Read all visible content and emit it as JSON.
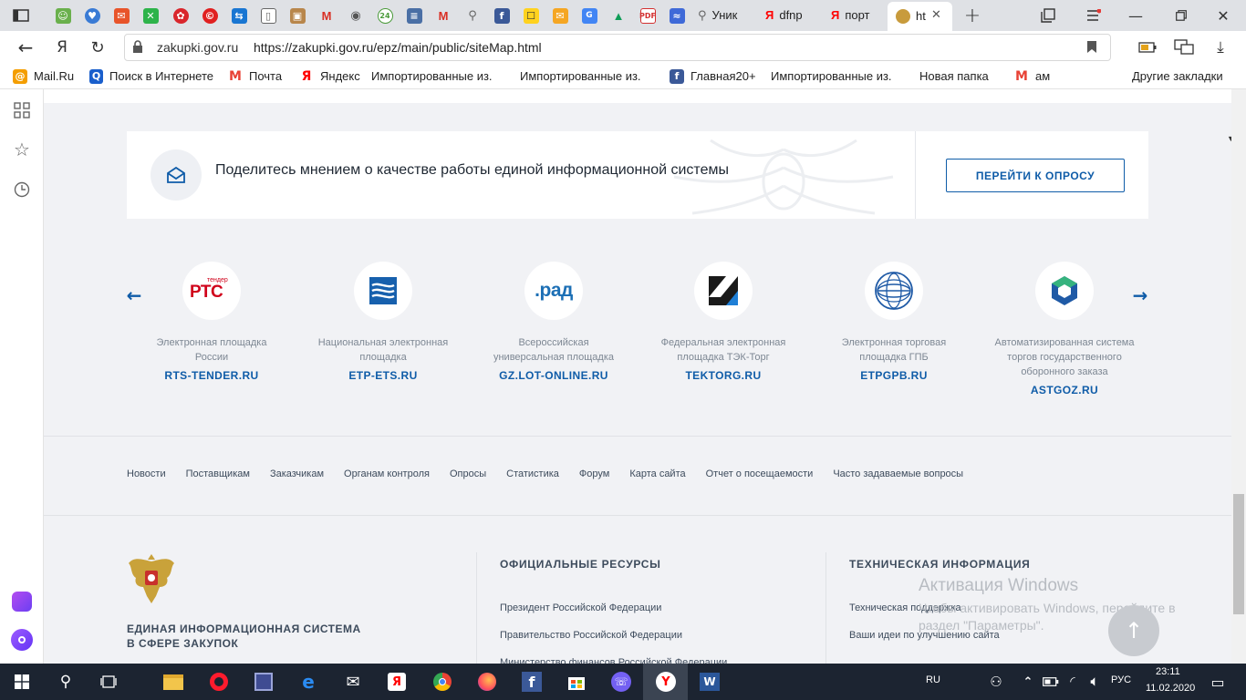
{
  "browser": {
    "tabs": [
      {
        "title": "Уник",
        "glyph": "⚲"
      },
      {
        "title": "dfnp",
        "glyph": "Я"
      },
      {
        "title": "порт",
        "glyph": "Я"
      },
      {
        "title": "ht",
        "glyph": "",
        "active": true
      }
    ],
    "address_domain": "zakupki.gov.ru",
    "address_url": "https://zakupki.gov.ru/epz/main/public/siteMap.html",
    "bookmarks": [
      {
        "label": "Mail.Ru",
        "icon": "mail-ru-icon",
        "color": "#f49e00",
        "glyph": "@"
      },
      {
        "label": "Поиск в Интернете",
        "icon": "search-icon",
        "color": "#1a5fcc",
        "glyph": "Q"
      },
      {
        "label": "Почта",
        "icon": "gmail-icon",
        "color": "#e84235",
        "glyph": "M"
      },
      {
        "label": "Яндекс",
        "icon": "yandex-icon",
        "color": "#ff0000",
        "glyph": "Я"
      },
      {
        "label": "Импортированные из...",
        "icon": "",
        "color": "",
        "glyph": "",
        "dropdown": true
      },
      {
        "label": "Импортированные из...",
        "icon": "",
        "color": "",
        "glyph": "",
        "dropdown": true
      },
      {
        "label": "Главная20+",
        "icon": "facebook-icon",
        "color": "#3b5998",
        "glyph": "f"
      },
      {
        "label": "Импортированные из...",
        "icon": "",
        "color": "",
        "glyph": "",
        "dropdown": true
      },
      {
        "label": "Новая папка",
        "icon": "",
        "color": "",
        "glyph": "",
        "dropdown": true
      },
      {
        "label": "ам",
        "icon": "gmail-icon",
        "color": "#e84235",
        "glyph": "M"
      },
      {
        "label": "Другие закладки",
        "icon": "",
        "color": "",
        "glyph": "",
        "dropdown": true
      }
    ]
  },
  "survey": {
    "text": "Поделитесь мнением о качестве работы единой информационной системы",
    "button": "ПЕРЕЙТИ К ОПРОСУ"
  },
  "platforms": [
    {
      "desc": "Электронная площадка России",
      "link": "RTS-TENDER.RU",
      "logo_text": "РТС",
      "logo_sub": "тендер"
    },
    {
      "desc": "Национальная электронная площадка",
      "link": "ETP-ETS.RU",
      "logo_text": "",
      "logo_sub": ""
    },
    {
      "desc": "Всероссийская универсальная площадка",
      "link": "GZ.LOT-ONLINE.RU",
      "logo_text": ".рад",
      "logo_sub": ""
    },
    {
      "desc": "Федеральная электронная площадка ТЭК-Торг",
      "link": "TEKTORG.RU",
      "logo_text": "",
      "logo_sub": ""
    },
    {
      "desc": "Электронная торговая площадка ГПБ",
      "link": "ETPGPB.RU",
      "logo_text": "",
      "logo_sub": ""
    },
    {
      "desc": "Автоматизированная система торгов государственного оборонного заказа",
      "link": "ASTGOZ.RU",
      "logo_text": "",
      "logo_sub": ""
    }
  ],
  "footer_nav": [
    "Новости",
    "Поставщикам",
    "Заказчикам",
    "Органам контроля",
    "Опросы",
    "Статистика",
    "Форум",
    "Карта сайта",
    "Отчет о посещаемости",
    "Часто задаваемые вопросы"
  ],
  "footer": {
    "system_name_line1": "ЕДИНАЯ ИНФОРМАЦИОННАЯ СИСТЕМА",
    "system_name_line2": "В СФЕРЕ ЗАКУПОК",
    "official_heading": "ОФИЦИАЛЬНЫЕ РЕСУРСЫ",
    "official_links": [
      "Президент Российской Федерации",
      "Правительство Российской Федерации",
      "Министерство финансов Российской Федерации"
    ],
    "tech_heading": "ТЕХНИЧЕСКАЯ ИНФОРМАЦИЯ",
    "tech_links": [
      "Техническая поддержка",
      "Ваши идеи по улучшению сайта"
    ]
  },
  "activation": {
    "title": "Активация Windows",
    "text": "Чтобы активировать Windows, перейдите в раздел \"Параметры\"."
  },
  "taskbar": {
    "lang_indicator": "RU",
    "input_lang": "РУС",
    "time": "23:11",
    "date": "11.02.2020"
  },
  "colors": {
    "accent": "#0f5ca8",
    "page_bg": "#f1f2f5",
    "taskbar": "#1c2431"
  }
}
